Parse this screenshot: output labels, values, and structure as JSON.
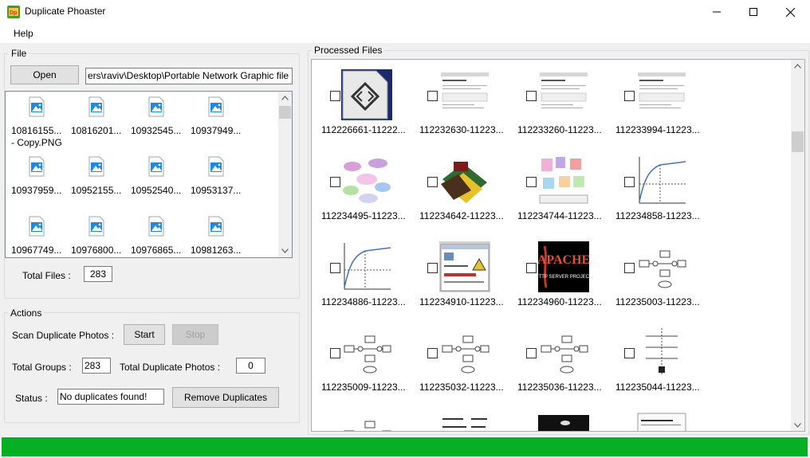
{
  "window": {
    "title": "Duplicate Phoaster"
  },
  "menu": {
    "help": "Help"
  },
  "file_group": {
    "title": "File",
    "open_label": "Open",
    "path_value": "ers\\raviv\\Desktop\\Portable Network Graphic file",
    "files": [
      {
        "line1": "10816155...",
        "line2": "- Copy.PNG"
      },
      {
        "line1": "10816201...",
        "line2": ""
      },
      {
        "line1": "10932545...",
        "line2": ""
      },
      {
        "line1": "10937949...",
        "line2": ""
      },
      {
        "line1": "10937959...",
        "line2": ""
      },
      {
        "line1": "10952155...",
        "line2": ""
      },
      {
        "line1": "10952540...",
        "line2": ""
      },
      {
        "line1": "10953137...",
        "line2": ""
      },
      {
        "line1": "10967749...",
        "line2": ""
      },
      {
        "line1": "10976800...",
        "line2": ""
      },
      {
        "line1": "10976865...",
        "line2": ""
      },
      {
        "line1": "10981263...",
        "line2": ""
      }
    ],
    "total_files_label": "Total Files :",
    "total_files_value": "283"
  },
  "actions_group": {
    "title": "Actions",
    "scan_label": "Scan Duplicate Photos :",
    "start_label": "Start",
    "stop_label": "Stop",
    "total_groups_label": "Total Groups :",
    "total_groups_value": "283",
    "total_dup_label": "Total Duplicate Photos :",
    "total_dup_value": "0",
    "status_label": "Status :",
    "status_value": "No duplicates found!",
    "remove_label": "Remove Duplicates"
  },
  "processed_group": {
    "title": "Processed Files",
    "items": [
      {
        "label": "112226661-11222...",
        "thumb": "code-icon"
      },
      {
        "label": "112232630-11223...",
        "thumb": "screenshot"
      },
      {
        "label": "112233260-11223...",
        "thumb": "screenshot"
      },
      {
        "label": "112233994-11223...",
        "thumb": "screenshot"
      },
      {
        "label": "112234495-11223...",
        "thumb": "bubbles"
      },
      {
        "label": "112234642-11223...",
        "thumb": "html-books"
      },
      {
        "label": "112234744-11223...",
        "thumb": "tags"
      },
      {
        "label": "112234858-11223...",
        "thumb": "graph"
      },
      {
        "label": "112234886-11223...",
        "thumb": "graph"
      },
      {
        "label": "112234910-11223...",
        "thumb": "webpage"
      },
      {
        "label": "112234960-11223...",
        "thumb": "apache"
      },
      {
        "label": "112235003-11223...",
        "thumb": "flow"
      },
      {
        "label": "112235009-11223...",
        "thumb": "flow"
      },
      {
        "label": "112235032-11223...",
        "thumb": "flow"
      },
      {
        "label": "112235036-11223...",
        "thumb": "flow"
      },
      {
        "label": "112235044-11223...",
        "thumb": "sequence"
      },
      {
        "label": "",
        "thumb": "flow"
      },
      {
        "label": "",
        "thumb": "text"
      },
      {
        "label": "",
        "thumb": "dark"
      },
      {
        "label": "",
        "thumb": "doc"
      }
    ],
    "apache_text": "APACHE",
    "apache_sub": "HTTP SERVER PROJECT"
  },
  "status_bar": {
    "progress_percent": 100,
    "color": "#06b025"
  }
}
